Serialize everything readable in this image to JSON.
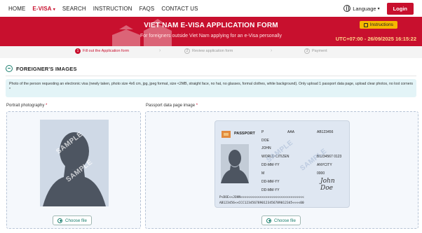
{
  "nav": {
    "items": [
      "HOME",
      "E-VISA",
      "SEARCH",
      "INSTRUCTION",
      "FAQS",
      "CONTACT US"
    ],
    "language": "Language",
    "login": "Login"
  },
  "banner": {
    "title": "VIET NAM E-VISA APPLICATION FORM",
    "subtitle": "For foreigners outside Viet Nam applying for an e-Visa personally",
    "instructions": "Instructions",
    "clock": "UTC+07:00 - 26/09/2025 16:15:22",
    "color": "#c8102e"
  },
  "steps": [
    {
      "num": "1",
      "label": "Fill out the Application form"
    },
    {
      "num": "2",
      "label": "Review application form"
    },
    {
      "num": "3",
      "label": "Payment"
    }
  ],
  "section": {
    "title": "FOREIGNER'S IMAGES",
    "notice": "Photo of the person requesting an electronic visa (newly taken, photo size 4x6 cm, jpg, jpeg format, size <2MB, straight face, no hat, no glasses, formal clothes, white background). Only upload 1 passport data page, upload clear photos, no lost corners *"
  },
  "portrait": {
    "label": "Portrait photography",
    "required_mark": "*",
    "watermark": "SAMPLE",
    "button": "Choose file"
  },
  "passport": {
    "label": "Passport data page image",
    "required_mark": "*",
    "watermark": "SAMPLE",
    "button": "Choose file",
    "doc_title": "PASSPORT",
    "fields": {
      "type": "P",
      "country_code": "AAA",
      "passport_no": "AB123456",
      "surname": "DOE",
      "given_names": "JOHN",
      "nationality": "WORLD CITIZEN",
      "personal_no": "B1234567 0123",
      "dob": "DD-MM-YY",
      "place_of_birth": "ANYCITY",
      "sex": "M",
      "auth": "0000",
      "date_of_issue": "DD-MM-YY",
      "date_of_expiry": "DD-MM-YY",
      "signature": "John Doe"
    },
    "mrz1": "P<DOE<<JOHN<<<<<<<<<<<<<<<<<<<<<<<<<<<<<<<<<",
    "mrz2": "AB123456<<CCC1234567890123456789012345<<<<00"
  }
}
